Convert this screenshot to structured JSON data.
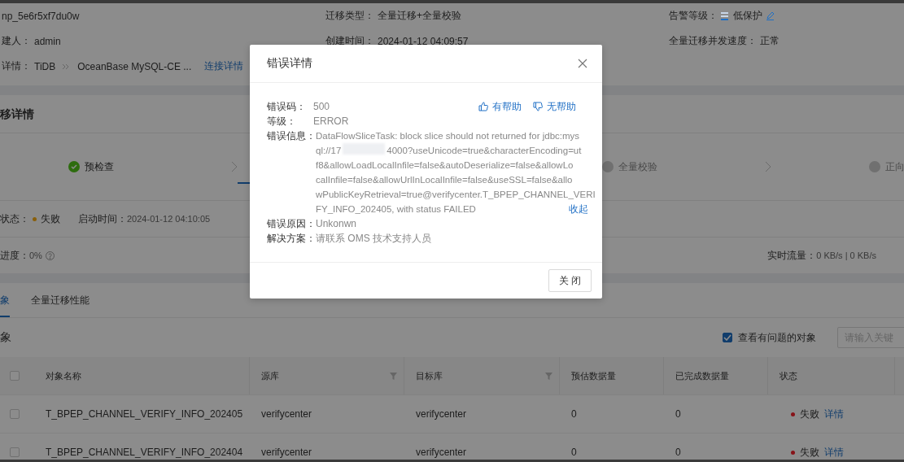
{
  "info": {
    "rows": [
      [
        {
          "value": "np_5e6r5xf7du0w"
        },
        {
          "label": "迁移类型：",
          "value": "全量迁移+全量校验"
        },
        {
          "label": "告警等级：",
          "value": "低保护",
          "kind": "alert"
        }
      ],
      [
        {
          "label": "建人：",
          "value": "admin"
        },
        {
          "label": "创建时间：",
          "value": "2024-01-12 04:09:57"
        },
        {
          "label": "全量迁移并发速度：",
          "value": "正常"
        }
      ],
      [
        {
          "label": "详情：",
          "value": "TiDB",
          "kind": "link",
          "target": "OceanBase MySQL-CE ...",
          "link": "连接详情"
        }
      ]
    ]
  },
  "card": {
    "title": "移详情",
    "steps": [
      {
        "label": "预检查",
        "kind": "done"
      },
      {
        "kind": "active"
      },
      {
        "label": "全量校验",
        "kind": "pending"
      },
      {
        "label": "正向",
        "kind": "pending"
      }
    ],
    "run_status": {
      "label": "状态：",
      "value": "失败",
      "color": "#895f0b",
      "start_label": "启动时间：",
      "start_value": "2024-01-12 04:10:05"
    },
    "progress": {
      "label": "进度：",
      "value": "0%",
      "traffic_label": "实时流量：",
      "traffic_value": "0 KB/s | 0 KB/s"
    }
  },
  "tabs": [
    {
      "label": "象",
      "selected": true
    },
    {
      "label": "全量迁移性能",
      "selected": false
    }
  ],
  "objects": {
    "title": "象",
    "select_all": {
      "checked": false
    },
    "filter": {
      "label": "查看有问题的对象",
      "checked": true
    },
    "search": {
      "placeholder": "请输入关键"
    },
    "columns": [
      {
        "label": "对象名称"
      },
      {
        "label": "源库",
        "filter": true
      },
      {
        "label": "目标库",
        "filter": true
      },
      {
        "label": "预估数据量"
      },
      {
        "label": "已完成数据量"
      },
      {
        "label": "状态"
      }
    ],
    "rows": [
      {
        "checked": false,
        "cells": [
          "T_BPEP_CHANNEL_VERIFY_INFO_202405",
          "verifycenter",
          "verifycenter",
          "0",
          "0"
        ],
        "status": "失败",
        "color": "#871319",
        "action": "详情"
      },
      {
        "checked": false,
        "cells": [
          "T_BPEP_CHANNEL_VERIFY_INFO_202404",
          "verifycenter",
          "verifycenter",
          "0",
          "0"
        ],
        "status": "失败",
        "color": "#871319",
        "action": "详情"
      }
    ]
  },
  "dialog": {
    "title": "错误详情",
    "feedback": [
      "有帮助",
      "无帮助"
    ],
    "fields": [
      {
        "label": "错误码：",
        "value": "500"
      },
      {
        "label": "等级：",
        "value": "ERROR"
      },
      {
        "label": "错误信息：",
        "kind": "message",
        "lines": [
          {
            "parts": [
              "DataFlowSliceTask: block slice should not returned for jdbc:mys"
            ]
          },
          {
            "parts": [
              "ql://17",
              "4000?useUnicode=true&characterEncoding=ut"
            ]
          },
          {
            "parts": [
              "f8&allowLoadLocalInfile=false&autoDeserialize=false&allowLo"
            ]
          },
          {
            "parts": [
              "calInfile=false&allowUrlInLocalInfile=false&useSSL=false&allo"
            ]
          },
          {
            "parts": [
              "wPublicKeyRetrieval=true@verifycenter.T_BPEP_CHANNEL_VERI"
            ]
          },
          {
            "parts": [
              "FY_INFO_202405, with status FAILED"
            ]
          }
        ],
        "collapse": "收起"
      },
      {
        "label": "错误原因：",
        "value": "Unkonwn"
      },
      {
        "label": "解决方案：",
        "value": "请联系 OMS 技术支持人员"
      }
    ],
    "button": "关 闭"
  }
}
